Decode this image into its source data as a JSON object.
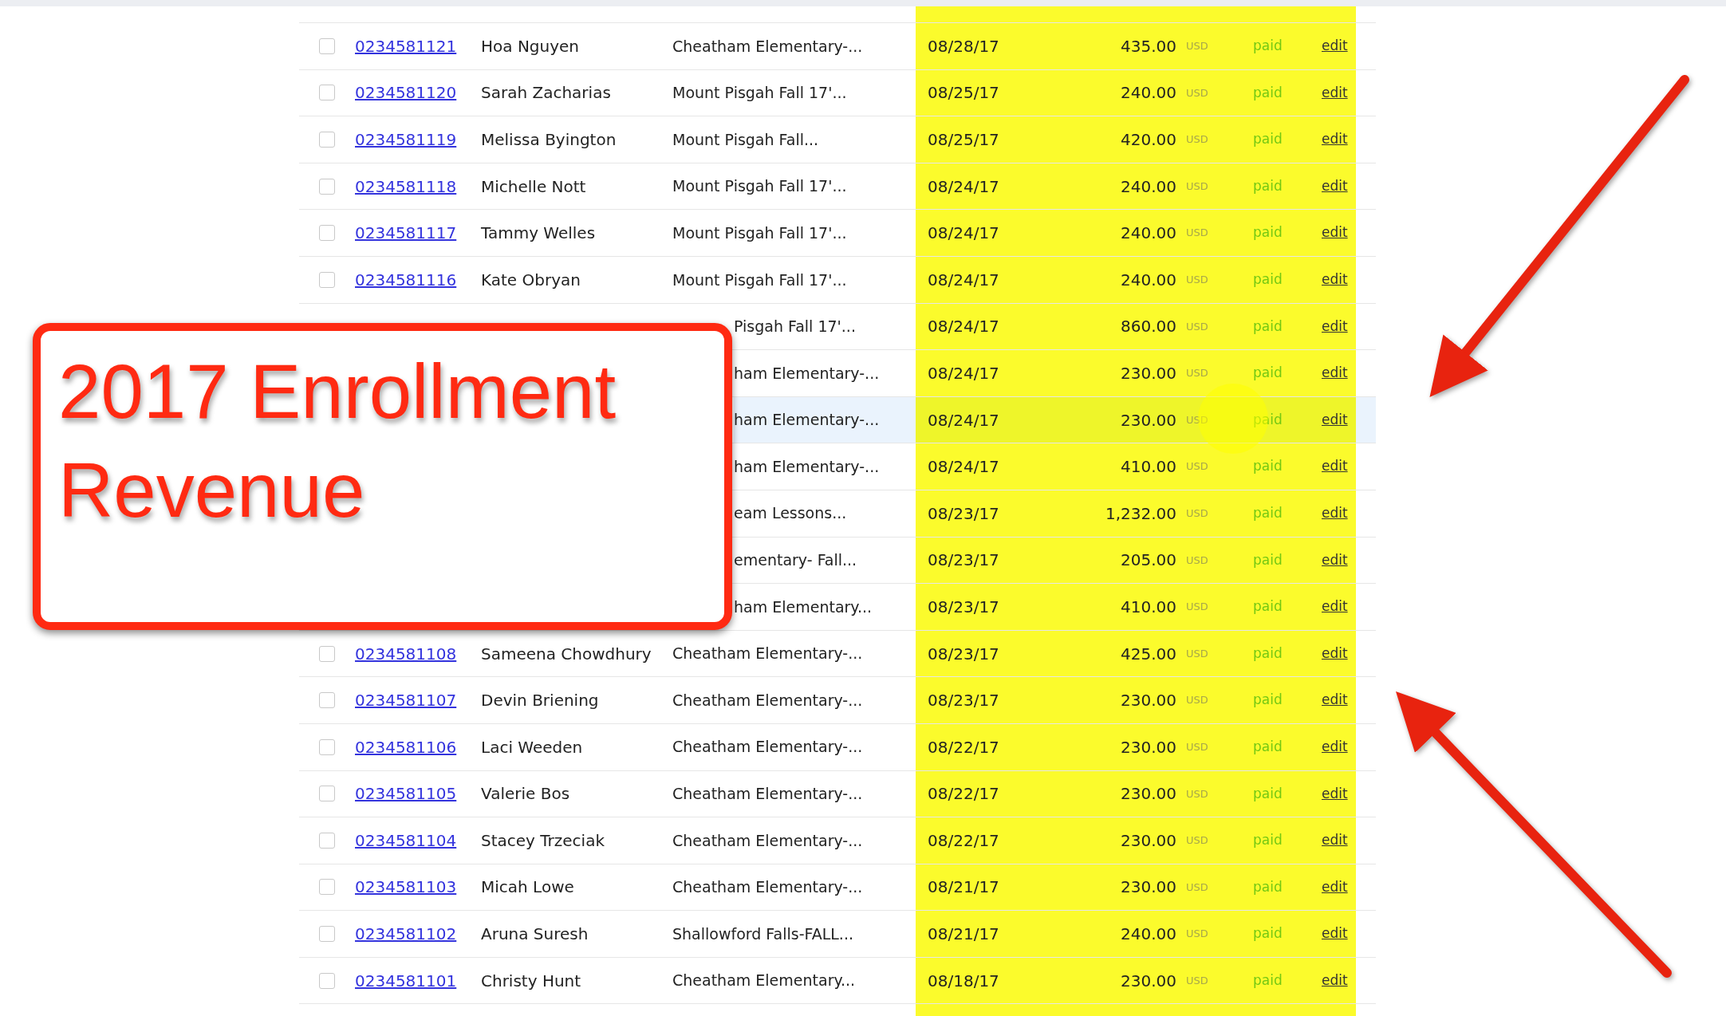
{
  "callout": {
    "text": "2017 Enrollment Revenue"
  },
  "rows": [
    {
      "checked": false,
      "id": "0234581121",
      "name": "Hoa Nguyen",
      "description": "Cheatham Elementary-...",
      "date": "08/28/17",
      "amount": "435.00",
      "currency": "USD",
      "status": "paid",
      "action": "edit",
      "highlighted": false
    },
    {
      "checked": false,
      "id": "0234581120",
      "name": "Sarah Zacharias",
      "description": "Mount Pisgah Fall 17'...",
      "date": "08/25/17",
      "amount": "240.00",
      "currency": "USD",
      "status": "paid",
      "action": "edit",
      "highlighted": false
    },
    {
      "checked": false,
      "id": "0234581119",
      "name": "Melissa Byington",
      "description": "Mount Pisgah Fall...",
      "date": "08/25/17",
      "amount": "420.00",
      "currency": "USD",
      "status": "paid",
      "action": "edit",
      "highlighted": false
    },
    {
      "checked": false,
      "id": "0234581118",
      "name": "Michelle Nott",
      "description": "Mount Pisgah Fall 17'...",
      "date": "08/24/17",
      "amount": "240.00",
      "currency": "USD",
      "status": "paid",
      "action": "edit",
      "highlighted": false
    },
    {
      "checked": false,
      "id": "0234581117",
      "name": "Tammy Welles",
      "description": "Mount Pisgah Fall 17'...",
      "date": "08/24/17",
      "amount": "240.00",
      "currency": "USD",
      "status": "paid",
      "action": "edit",
      "highlighted": false
    },
    {
      "checked": false,
      "id": "0234581116",
      "name": "Kate Obryan",
      "description": "Mount Pisgah Fall 17'...",
      "date": "08/24/17",
      "amount": "240.00",
      "currency": "USD",
      "status": "paid",
      "action": "edit",
      "highlighted": false
    },
    {
      "description": "Pisgah Fall 17'...",
      "date": "08/24/17",
      "amount": "860.00",
      "currency": "USD",
      "status": "paid",
      "action": "edit",
      "highlighted": false
    },
    {
      "description": "ham Elementary-...",
      "date": "08/24/17",
      "amount": "230.00",
      "currency": "USD",
      "status": "paid",
      "action": "edit",
      "highlighted": false
    },
    {
      "description": "ham Elementary-...",
      "date": "08/24/17",
      "amount": "230.00",
      "currency": "USD",
      "status": "paid",
      "action": "edit",
      "highlighted": true
    },
    {
      "description": "ham Elementary-...",
      "date": "08/24/17",
      "amount": "410.00",
      "currency": "USD",
      "status": "paid",
      "action": "edit",
      "highlighted": false
    },
    {
      "description": "eam Lessons...",
      "date": "08/23/17",
      "amount": "1,232.00",
      "currency": "USD",
      "status": "paid",
      "action": "edit",
      "highlighted": false
    },
    {
      "description": "ementary- Fall...",
      "date": "08/23/17",
      "amount": "205.00",
      "currency": "USD",
      "status": "paid",
      "action": "edit",
      "highlighted": false
    },
    {
      "description": "ham Elementary...",
      "date": "08/23/17",
      "amount": "410.00",
      "currency": "USD",
      "status": "paid",
      "action": "edit",
      "highlighted": false
    },
    {
      "checked": false,
      "id": "0234581108",
      "name": "Sameena Chowdhury",
      "description": "Cheatham Elementary-...",
      "date": "08/23/17",
      "amount": "425.00",
      "currency": "USD",
      "status": "paid",
      "action": "edit",
      "highlighted": false
    },
    {
      "checked": false,
      "id": "0234581107",
      "name": "Devin Briening",
      "description": "Cheatham Elementary-...",
      "date": "08/23/17",
      "amount": "230.00",
      "currency": "USD",
      "status": "paid",
      "action": "edit",
      "highlighted": false
    },
    {
      "checked": false,
      "id": "0234581106",
      "name": "Laci Weeden",
      "description": "Cheatham Elementary-...",
      "date": "08/22/17",
      "amount": "230.00",
      "currency": "USD",
      "status": "paid",
      "action": "edit",
      "highlighted": false
    },
    {
      "checked": false,
      "id": "0234581105",
      "name": "Valerie Bos",
      "description": "Cheatham Elementary-...",
      "date": "08/22/17",
      "amount": "230.00",
      "currency": "USD",
      "status": "paid",
      "action": "edit",
      "highlighted": false
    },
    {
      "checked": false,
      "id": "0234581104",
      "name": "Stacey Trzeciak",
      "description": "Cheatham Elementary-...",
      "date": "08/22/17",
      "amount": "230.00",
      "currency": "USD",
      "status": "paid",
      "action": "edit",
      "highlighted": false
    },
    {
      "checked": false,
      "id": "0234581103",
      "name": "Micah Lowe",
      "description": "Cheatham Elementary-...",
      "date": "08/21/17",
      "amount": "230.00",
      "currency": "USD",
      "status": "paid",
      "action": "edit",
      "highlighted": false
    },
    {
      "checked": false,
      "id": "0234581102",
      "name": "Aruna Suresh",
      "description": "Shallowford Falls-FALL...",
      "date": "08/21/17",
      "amount": "240.00",
      "currency": "USD",
      "status": "paid",
      "action": "edit",
      "highlighted": false
    },
    {
      "checked": false,
      "id": "0234581101",
      "name": "Christy Hunt",
      "description": "Cheatham Elementary...",
      "date": "08/18/17",
      "amount": "230.00",
      "currency": "USD",
      "status": "paid",
      "action": "edit",
      "highlighted": false
    }
  ]
}
